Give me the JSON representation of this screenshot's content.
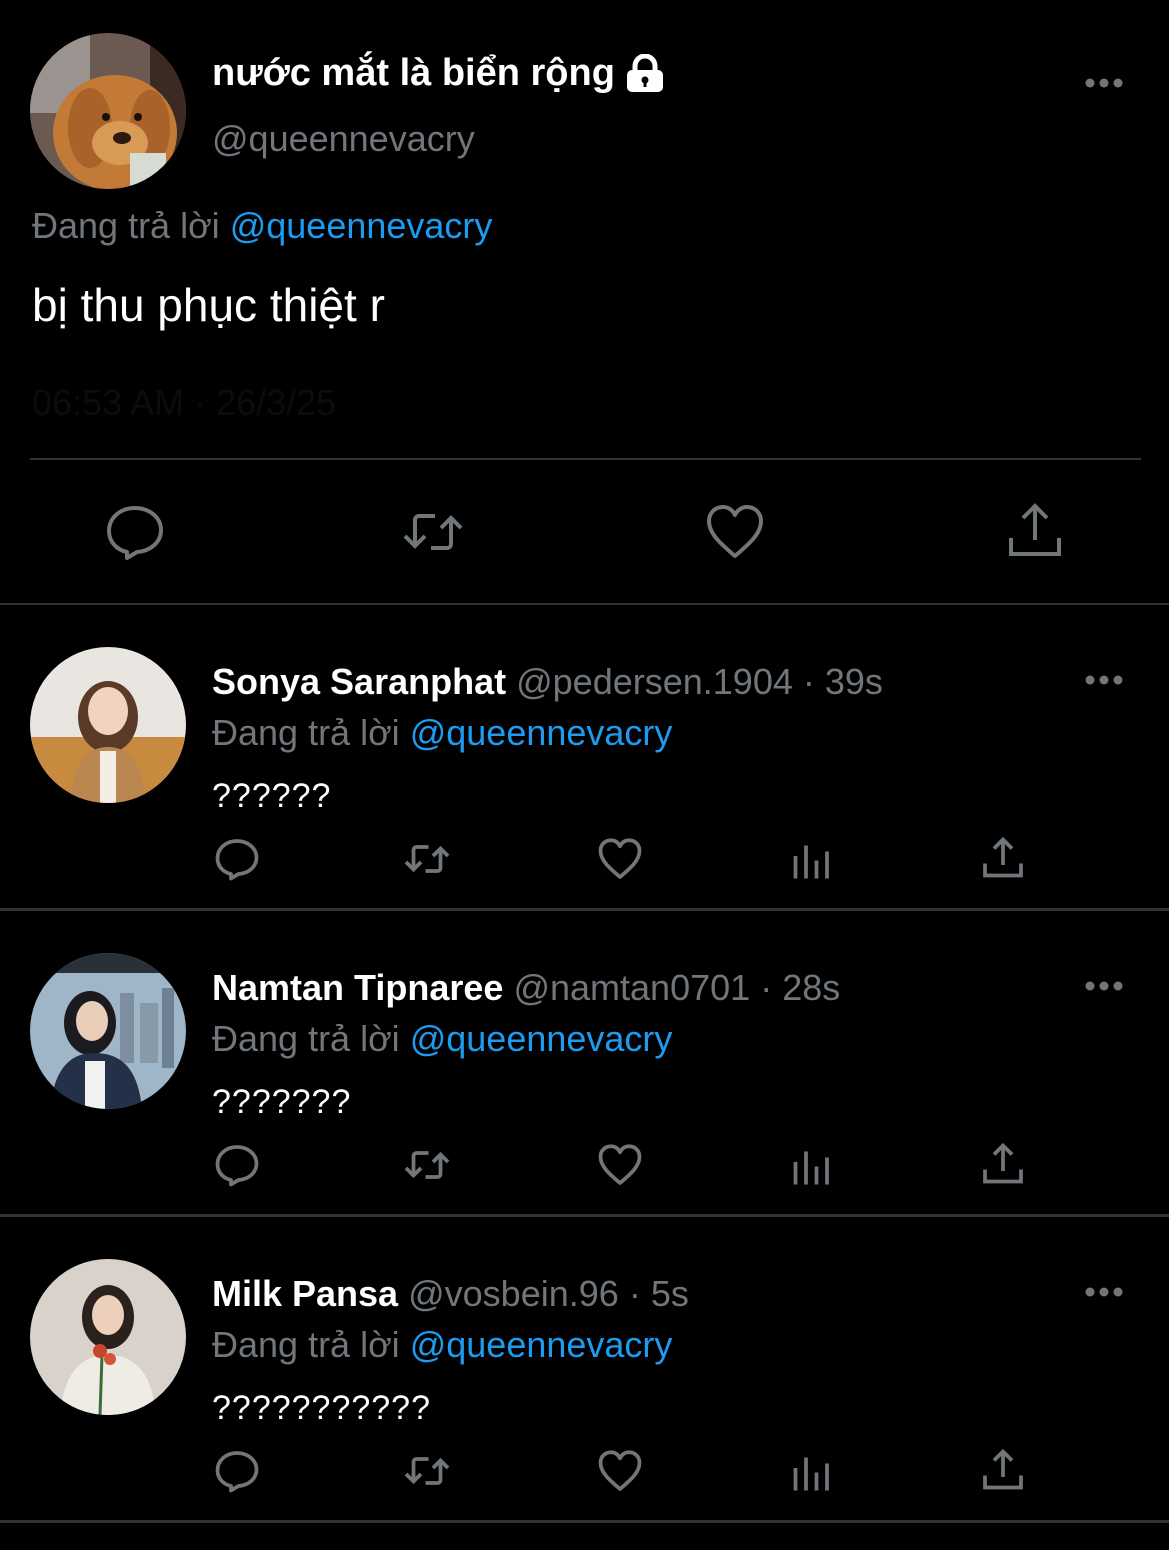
{
  "main_tweet": {
    "display_name": "nước mắt là biển rộng",
    "handle": "@queennevacry",
    "reply_prefix": "Đang trả lời",
    "reply_to": "@queennevacry",
    "text": "bị thu phục thiệt r",
    "meta": "06:53 AM · 26/3/25",
    "icons": [
      "lock-icon",
      "more-icon",
      "reply-icon",
      "retweet-icon",
      "like-icon",
      "share-icon"
    ]
  },
  "replies": [
    {
      "display_name": "Sonya Saranphat",
      "handle": "@pedersen.1904",
      "dot": "·",
      "time": "39s",
      "reply_prefix": "Đang trả lời",
      "reply_to": "@queennevacry",
      "text": "??????"
    },
    {
      "display_name": "Namtan Tipnaree",
      "handle": "@namtan0701",
      "dot": "·",
      "time": "28s",
      "reply_prefix": "Đang trả lời",
      "reply_to": "@queennevacry",
      "text": "???????"
    },
    {
      "display_name": "Milk Pansa",
      "handle": "@vosbein.96",
      "dot": "·",
      "time": "5s",
      "reply_prefix": "Đang trả lời",
      "reply_to": "@queennevacry",
      "text": "???????????"
    }
  ],
  "colors": {
    "background": "#000000",
    "text_primary": "#ffffff",
    "text_secondary": "#71767b",
    "accent_link": "#1d9bf0",
    "divider": "#2f3336"
  }
}
